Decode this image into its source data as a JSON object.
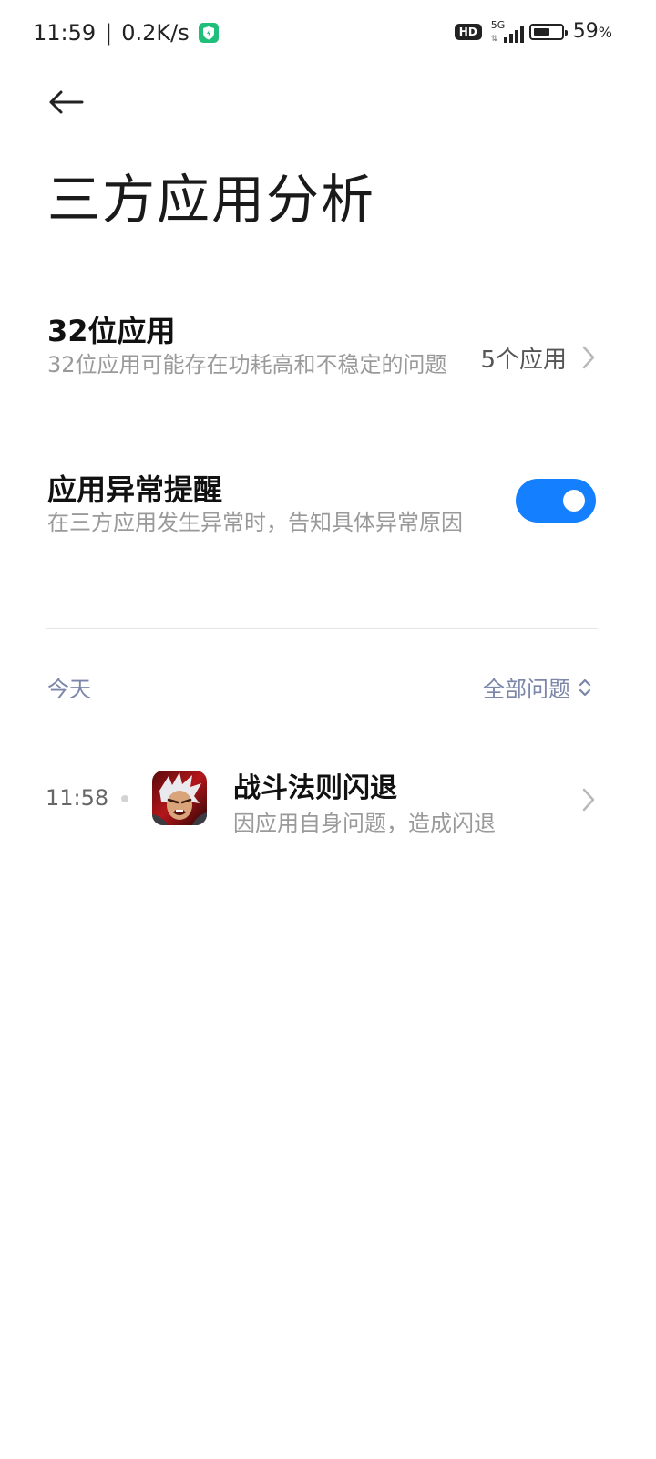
{
  "status_bar": {
    "time": "11:59",
    "separator": "|",
    "net_speed": "0.2K/s",
    "hd": "HD",
    "network": "5G",
    "net_arrows": "⇅",
    "battery_level": 0.59,
    "battery_text": "59",
    "battery_unit": "%"
  },
  "header": {
    "title": "三方应用分析"
  },
  "settings": {
    "bit32": {
      "title": "32位应用",
      "description": "32位应用可能存在功耗高和不稳定的问题",
      "value": "5个应用"
    },
    "crash_alert": {
      "title": "应用异常提醒",
      "description": "在三方应用发生异常时，告知具体异常原因",
      "enabled": true
    }
  },
  "list": {
    "date_label": "今天",
    "filter_label": "全部问题",
    "events": [
      {
        "time": "11:58",
        "app_name": "战斗法则闪退",
        "reason": "因应用自身问题，造成闪退",
        "icon": "game-app-icon"
      }
    ]
  },
  "colors": {
    "accent": "#1480ff",
    "muted_text": "#9a9a9a",
    "section_label": "#7b86a8"
  }
}
